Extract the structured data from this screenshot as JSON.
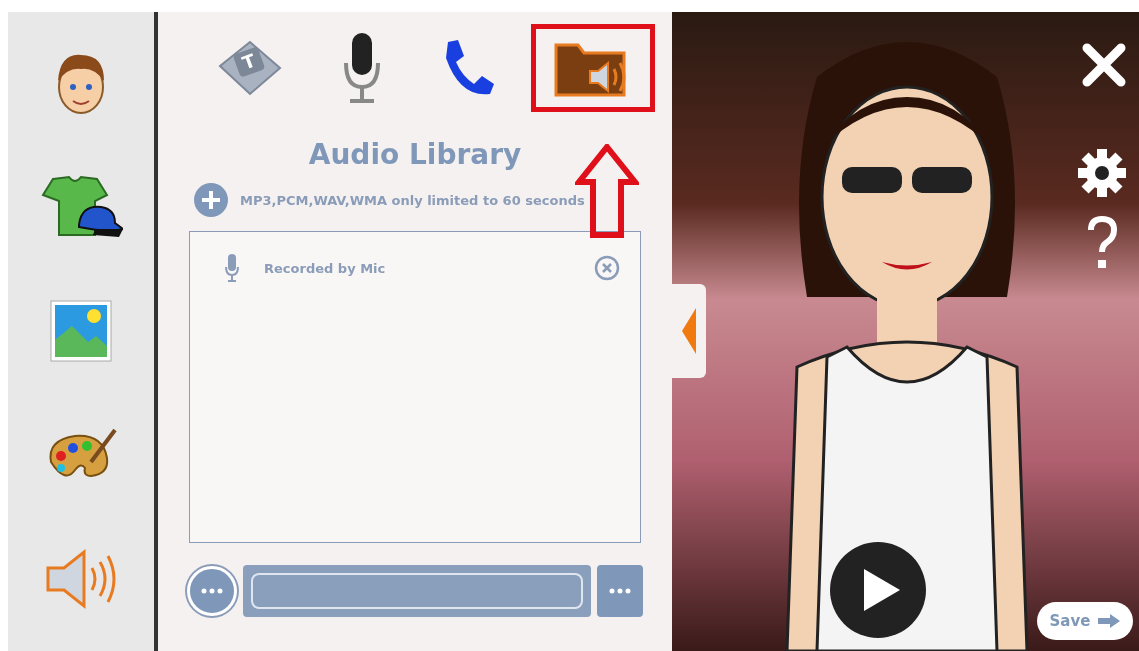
{
  "sidebar": {
    "items": [
      {
        "kind": "character"
      },
      {
        "kind": "outfit"
      },
      {
        "kind": "background"
      },
      {
        "kind": "colors"
      },
      {
        "kind": "audio"
      }
    ]
  },
  "tabs": [
    {
      "kind": "text",
      "key_label": "T",
      "selected": false
    },
    {
      "kind": "mic",
      "selected": false
    },
    {
      "kind": "phone",
      "selected": false
    },
    {
      "kind": "library",
      "selected": true
    }
  ],
  "panel": {
    "title": "Audio Library",
    "hint": "MP3,PCM,WAV,WMA only limited to 60 seconds",
    "audio_items": [
      {
        "kind": "mic",
        "label": "Recorded by Mic"
      }
    ]
  },
  "stage": {
    "save_button": "Save"
  }
}
